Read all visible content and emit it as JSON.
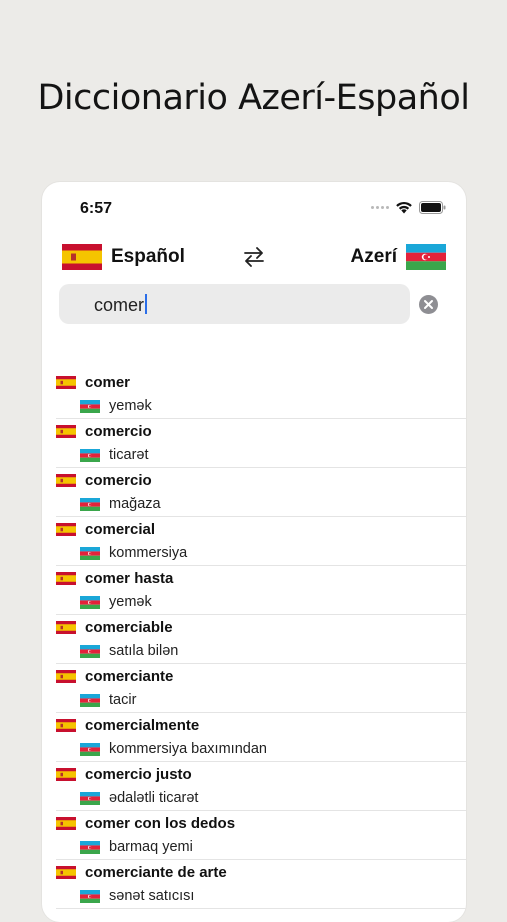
{
  "headline": "Diccionario Azerí-Español",
  "status": {
    "time": "6:57"
  },
  "languages": {
    "source": "Español",
    "target": "Azerí"
  },
  "search": {
    "value": "comer"
  },
  "colors": {
    "accent": "#2b6ee8",
    "az_blue": "#1aa7d8",
    "az_red": "#e3223a",
    "az_green": "#3aa64b",
    "es_red": "#c8102e",
    "es_yellow": "#f5c400"
  },
  "icons": {
    "swap": "swap-arrows-icon",
    "clear": "clear-circle-icon",
    "wifi": "wifi-icon",
    "battery": "battery-icon"
  },
  "results": [
    {
      "word": "comer",
      "translation": "yemək"
    },
    {
      "word": "comercio",
      "translation": "ticarət"
    },
    {
      "word": "comercio",
      "translation": "mağaza"
    },
    {
      "word": "comercial",
      "translation": "kommersiya"
    },
    {
      "word": "comer hasta",
      "translation": "yemək"
    },
    {
      "word": "comerciable",
      "translation": "satıla bilən"
    },
    {
      "word": "comerciante",
      "translation": "tacir"
    },
    {
      "word": "comercialmente",
      "translation": "kommersiya baxımından"
    },
    {
      "word": "comercio justo",
      "translation": "ədalətli ticarət"
    },
    {
      "word": "comer con los dedos",
      "translation": "barmaq yemi"
    },
    {
      "word": "comerciante de arte",
      "translation": "sənət satıcısı"
    }
  ]
}
